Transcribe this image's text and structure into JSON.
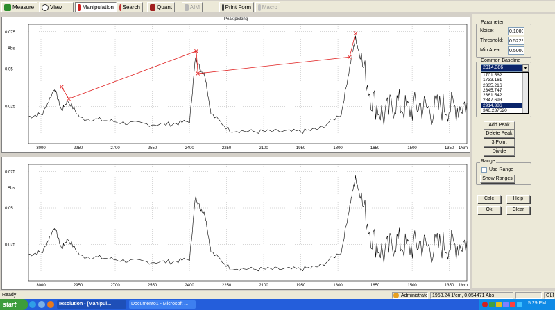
{
  "toolbar": {
    "buttons": [
      {
        "label": "Measure"
      },
      {
        "label": "View"
      },
      {
        "label": "Manipulation"
      },
      {
        "label": "Search"
      },
      {
        "label": "Quant"
      },
      {
        "label": "AIM"
      },
      {
        "label": "Print Form"
      },
      {
        "label": "Macro"
      }
    ]
  },
  "plot_top": {
    "title": "Peak picking",
    "y_unit": "Abs",
    "x_unit": "1/cm",
    "y_ticks": [
      "0.075",
      "0.05",
      "0.025"
    ],
    "x_ticks": [
      "3000",
      "2950",
      "2700",
      "2550",
      "2400",
      "2250",
      "2100",
      "1950",
      "1800",
      "1650",
      "1500",
      "1350"
    ]
  },
  "plot_bottom": {
    "y_unit": "Abs",
    "x_unit": "1/cm",
    "y_ticks": [
      "0.075",
      "0.05",
      "0.025"
    ],
    "x_ticks": [
      "3000",
      "2950",
      "2700",
      "2550",
      "2400",
      "2250",
      "2100",
      "1950",
      "1800",
      "1650",
      "1500",
      "1350"
    ]
  },
  "chart_data": [
    {
      "type": "line",
      "title": "Peak picking",
      "xlabel": "1/cm",
      "ylabel": "Abs",
      "xlim": [
        3100,
        1250
      ],
      "ylim": [
        0,
        0.08
      ],
      "x_ticks": [
        3000,
        2950,
        2700,
        2550,
        2400,
        2250,
        2100,
        1950,
        1800,
        1650,
        1500,
        1350
      ],
      "series": [
        {
          "x": [
            3100,
            3040,
            2990,
            2960,
            2935,
            2880,
            2800,
            2700,
            2600,
            2500,
            2420,
            2395,
            2375,
            2355,
            2330,
            2250,
            2150,
            2050,
            1950,
            1870,
            1780,
            1740,
            1720,
            1700,
            1650,
            1600,
            1550,
            1500,
            1450,
            1400,
            1350,
            1300,
            1250
          ],
          "y": [
            0.018,
            0.02,
            0.037,
            0.022,
            0.029,
            0.017,
            0.016,
            0.014,
            0.013,
            0.013,
            0.015,
            0.058,
            0.05,
            0.046,
            0.02,
            0.009,
            0.008,
            0.008,
            0.008,
            0.01,
            0.02,
            0.055,
            0.071,
            0.058,
            0.03,
            0.018,
            0.028,
            0.022,
            0.026,
            0.022,
            0.025,
            0.024,
            0.027
          ]
        }
      ],
      "peaks": [
        {
          "x": 2960,
          "y": 0.038
        },
        {
          "x": 2930,
          "y": 0.03
        },
        {
          "x": 2392,
          "y": 0.062
        },
        {
          "x": 2385,
          "y": 0.047
        },
        {
          "x": 1745,
          "y": 0.058
        },
        {
          "x": 1720,
          "y": 0.074
        }
      ]
    },
    {
      "type": "line",
      "xlabel": "1/cm",
      "ylabel": "Abs",
      "xlim": [
        3100,
        1250
      ],
      "ylim": [
        0,
        0.08
      ],
      "x_ticks": [
        3000,
        2950,
        2700,
        2550,
        2400,
        2250,
        2100,
        1950,
        1800,
        1650,
        1500,
        1350
      ],
      "series": [
        {
          "x": [
            3100,
            3040,
            2990,
            2960,
            2935,
            2880,
            2800,
            2700,
            2600,
            2500,
            2420,
            2395,
            2375,
            2355,
            2330,
            2250,
            2150,
            2050,
            1950,
            1870,
            1780,
            1740,
            1720,
            1700,
            1650,
            1600,
            1550,
            1500,
            1450,
            1400,
            1350,
            1300,
            1250
          ],
          "y": [
            0.018,
            0.02,
            0.037,
            0.022,
            0.029,
            0.017,
            0.016,
            0.014,
            0.013,
            0.013,
            0.015,
            0.058,
            0.05,
            0.046,
            0.02,
            0.009,
            0.008,
            0.008,
            0.008,
            0.01,
            0.02,
            0.055,
            0.071,
            0.058,
            0.03,
            0.018,
            0.028,
            0.022,
            0.026,
            0.022,
            0.025,
            0.024,
            0.027
          ]
        }
      ]
    }
  ],
  "panel": {
    "parameter_title": "Parameter",
    "noise_label": "Noise:",
    "noise_value": "0.1000",
    "threshold_label": "Threshold:",
    "threshold_value": "0.5229",
    "min_area_label": "Min Area:",
    "min_area_value": "0.5000",
    "baseline_title": "Common Baseline",
    "baseline_selected": "2914.386",
    "baseline_options": [
      "1701.562",
      "1733.161",
      "2335.216",
      "2345.747",
      "2361.542",
      "2847.693",
      "2914.386",
      "346.237520"
    ],
    "add_peak": "Add Peak",
    "delete_peak": "Delete Peak",
    "three_point": "3 Point",
    "divide": "Divide",
    "range_title": "Range",
    "use_range": "Use Range",
    "show_ranges": "Show Ranges",
    "calc": "Calc",
    "help": "Help",
    "ok": "Ok",
    "clear": "Clear"
  },
  "status": {
    "ready": "Ready",
    "user": "Administrator",
    "cursor": "1953.24 1/cm, 0.054471 Abs",
    "mode": "GLP"
  },
  "taskbar": {
    "start": "start",
    "tasks": [
      "IRsolution - [Manipul...",
      "Documento1 - Microsoft ..."
    ],
    "clock": "5:29 PM"
  }
}
